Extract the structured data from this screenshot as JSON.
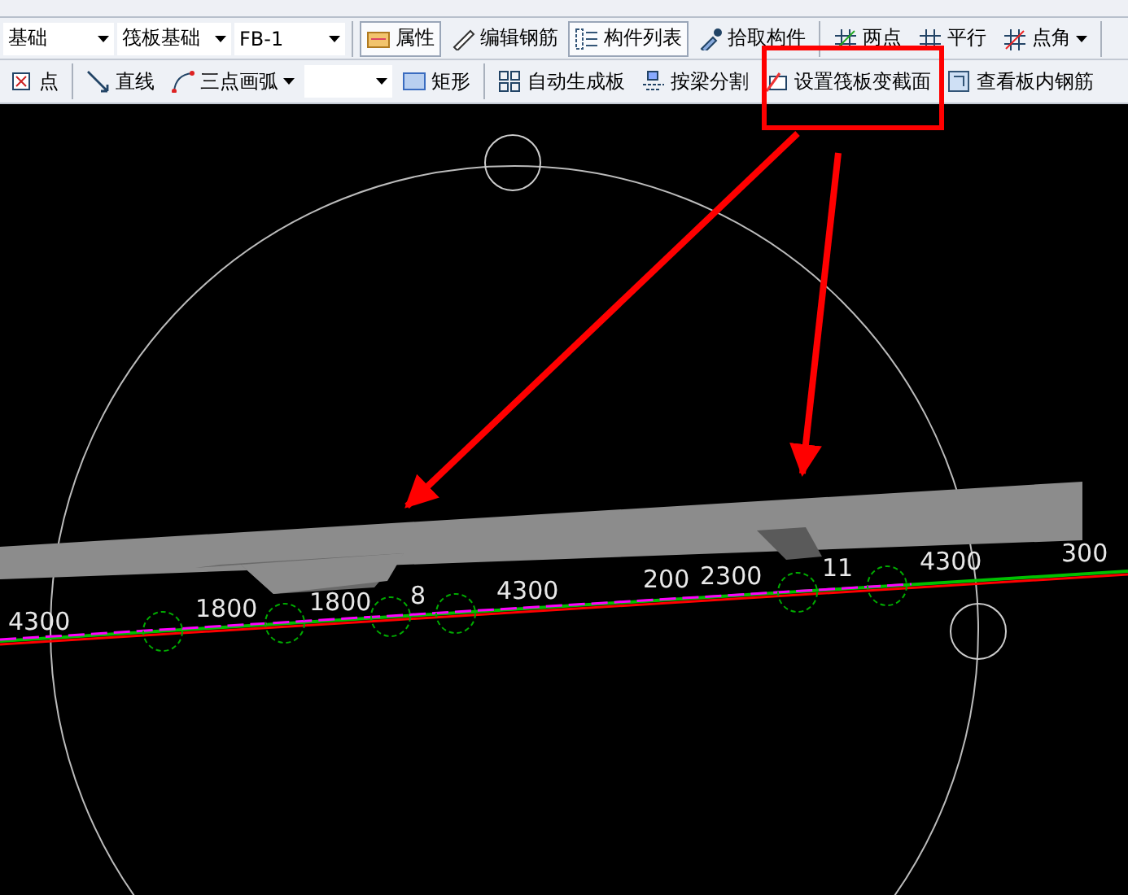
{
  "toolbar_1": {
    "combos": [
      {
        "value": "基础"
      },
      {
        "value": "筏板基础"
      },
      {
        "value": "FB-1"
      }
    ],
    "buttons": [
      {
        "label": "属性",
        "selected": true,
        "kind": "button"
      },
      {
        "label": "编辑钢筋",
        "selected": false,
        "kind": "button"
      },
      {
        "label": "构件列表",
        "selected": true,
        "kind": "button"
      },
      {
        "label": "拾取构件",
        "selected": false,
        "kind": "button"
      },
      {
        "label": "两点",
        "selected": false,
        "kind": "button"
      },
      {
        "label": "平行",
        "selected": false,
        "kind": "button"
      },
      {
        "label": "点角",
        "selected": false,
        "kind": "dropdown"
      }
    ]
  },
  "toolbar_2": {
    "buttons": [
      {
        "label": "点",
        "kind": "button"
      },
      {
        "label": "直线",
        "kind": "button"
      },
      {
        "label": "三点画弧",
        "kind": "dropdown"
      },
      {
        "kind": "combo"
      },
      {
        "label": "矩形",
        "kind": "button"
      },
      {
        "label": "自动生成板",
        "kind": "button"
      },
      {
        "label": "按梁分割",
        "kind": "button"
      },
      {
        "label": "设置筏板变截面",
        "kind": "button"
      },
      {
        "label": "查看板内钢筋",
        "kind": "button"
      }
    ]
  },
  "canvas": {
    "dimension_labels": [
      "4300",
      "1800",
      "1800",
      "8",
      "4300",
      "200",
      "2300",
      "11",
      "4300",
      "300"
    ]
  }
}
